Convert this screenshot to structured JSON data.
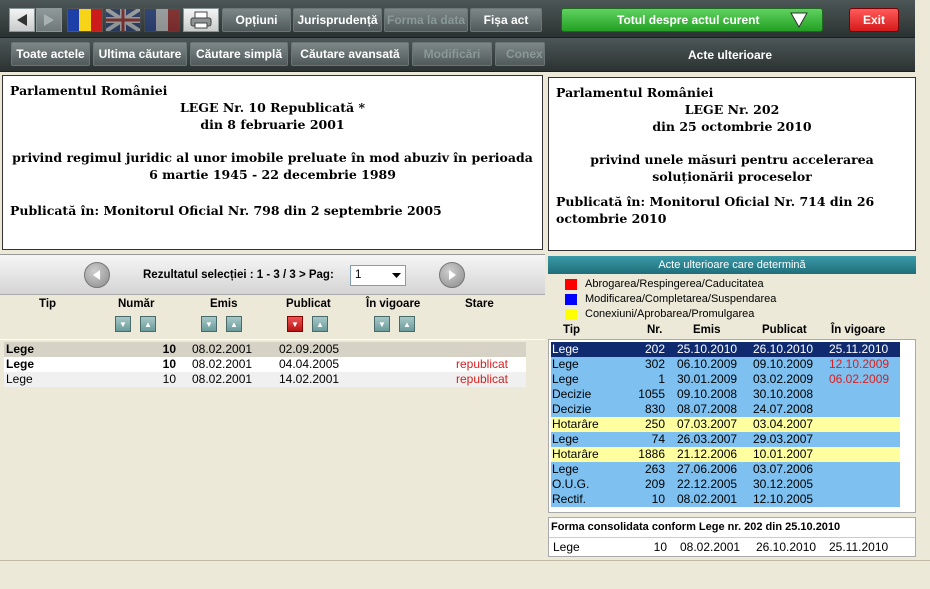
{
  "toolbar": {
    "back_icon": "back-arrow-icon",
    "forward_icon": "forward-arrow-icon",
    "flags": [
      "romania-flag-icon",
      "uk-flag-icon",
      "france-flag-icon"
    ],
    "print_icon": "printer-icon",
    "optiuni": "Opțiuni",
    "jurisprudenta": "Jurisprudență",
    "forma_la_data": "Forma la data",
    "fisa_act": "Fișa act"
  },
  "secondbar": {
    "toate_actele": "Toate actele",
    "ultima_cautare": "Ultima căutare",
    "cautare_simpla": "Căutare simplă",
    "cautare_avansata": "Căutare avansată",
    "modificari": "Modificări",
    "conexiuni": "Conex"
  },
  "right_toolbar": {
    "totul_despre": "Totul despre actul curent",
    "exit": "Exit",
    "acte_ulterioare": "Acte ulterioare"
  },
  "left_doc": {
    "issuer": "Parlamentul României",
    "title": "LEGE Nr. 10 Republicată *",
    "date": "din 8 februarie 2001",
    "subject": "privind regimul juridic al unor imobile preluate în mod abuziv în perioada 6 martie 1945 - 22 decembrie 1989",
    "published": "Publicată în: Monitorul Oficial Nr. 798 din 2 septembrie 2005"
  },
  "right_doc": {
    "issuer": "Parlamentul României",
    "title": "LEGE Nr. 202",
    "date": "din 25 octombrie 2010",
    "subject": "privind unele măsuri pentru accelerarea soluționării proceselor",
    "published": "Publicată în: Monitorul Oficial Nr. 714 din 26 octombrie 2010"
  },
  "pager": {
    "label": "Rezultatul selecției : 1 - 3 / 3 > Pag:",
    "page_value": "1"
  },
  "left_table": {
    "headers": [
      "Tip",
      "Număr",
      "Emis",
      "Publicat",
      "În vigoare",
      "Stare"
    ],
    "rows": [
      {
        "tip": "Lege",
        "numar": "10",
        "emis": "08.02.2001",
        "publicat": "02.09.2005",
        "stare": ""
      },
      {
        "tip": "Lege",
        "numar": "10",
        "emis": "08.02.2001",
        "publicat": "04.04.2005",
        "stare": "republicat"
      },
      {
        "tip": "Lege",
        "numar": "10",
        "emis": "08.02.2001",
        "publicat": "14.02.2001",
        "stare": "republicat"
      }
    ]
  },
  "right_panel": {
    "header": "Acte ulterioare care determină",
    "legend": [
      {
        "label": "Abrogarea/Respingerea/Caducitatea",
        "color": "#ff0000"
      },
      {
        "label": "Modificarea/Completarea/Suspendarea",
        "color": "#0000ff"
      },
      {
        "label": "Conexiuni/Aprobarea/Promulgarea",
        "color": "#ffff00"
      }
    ],
    "headers": [
      "Tip",
      "Nr.",
      "Emis",
      "Publicat",
      "În vigoare"
    ],
    "rows": [
      {
        "tip": "Lege",
        "nr": "202",
        "emis": "25.10.2010",
        "publicat": "26.10.2010",
        "vigoare": "25.11.2010",
        "bg": "#0f2a6e",
        "fg": "#ffffff"
      },
      {
        "tip": "Lege",
        "nr": "302",
        "emis": "06.10.2009",
        "publicat": "09.10.2009",
        "vigoare": "12.10.2009",
        "bg": "#7ec0f0",
        "fg": "#000000",
        "vig_red": true
      },
      {
        "tip": "Lege",
        "nr": "1",
        "emis": "30.01.2009",
        "publicat": "03.02.2009",
        "vigoare": "06.02.2009",
        "bg": "#7ec0f0",
        "fg": "#000000",
        "vig_red": true
      },
      {
        "tip": "Decizie",
        "nr": "1055",
        "emis": "09.10.2008",
        "publicat": "30.10.2008",
        "vigoare": "",
        "bg": "#7ec0f0",
        "fg": "#000000"
      },
      {
        "tip": "Decizie",
        "nr": "830",
        "emis": "08.07.2008",
        "publicat": "24.07.2008",
        "vigoare": "",
        "bg": "#7ec0f0",
        "fg": "#000000"
      },
      {
        "tip": "Hotarâre",
        "nr": "250",
        "emis": "07.03.2007",
        "publicat": "03.04.2007",
        "vigoare": "",
        "bg": "#ffffa0",
        "fg": "#000000"
      },
      {
        "tip": "Lege",
        "nr": "74",
        "emis": "26.03.2007",
        "publicat": "29.03.2007",
        "vigoare": "",
        "bg": "#7ec0f0",
        "fg": "#000000"
      },
      {
        "tip": "Hotarâre",
        "nr": "1886",
        "emis": "21.12.2006",
        "publicat": "10.01.2007",
        "vigoare": "",
        "bg": "#ffffa0",
        "fg": "#000000"
      },
      {
        "tip": "Lege",
        "nr": "263",
        "emis": "27.06.2006",
        "publicat": "03.07.2006",
        "vigoare": "",
        "bg": "#7ec0f0",
        "fg": "#000000"
      },
      {
        "tip": "O.U.G.",
        "nr": "209",
        "emis": "22.12.2005",
        "publicat": "30.12.2005",
        "vigoare": "",
        "bg": "#7ec0f0",
        "fg": "#000000"
      },
      {
        "tip": "Rectif.",
        "nr": "10",
        "emis": "08.02.2001",
        "publicat": "12.10.2005",
        "vigoare": "",
        "bg": "#7ec0f0",
        "fg": "#000000"
      }
    ],
    "consolidated_label": "Forma consolidata conform Lege nr. 202 din 25.10.2010",
    "consolidated": {
      "tip": "Lege",
      "nr": "10",
      "emis": "08.02.2001",
      "publicat": "26.10.2010",
      "vigoare": "25.11.2010"
    }
  }
}
